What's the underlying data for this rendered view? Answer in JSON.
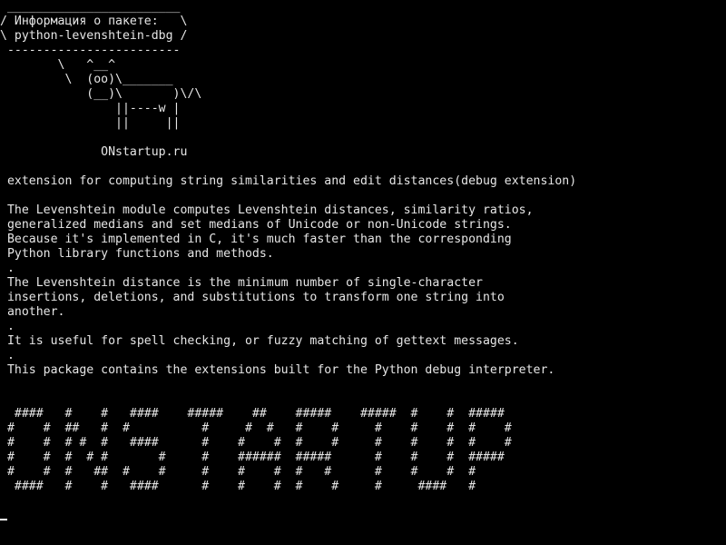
{
  "colors": {
    "background": "#000000",
    "foreground": "#e6e6e6",
    "cursor": "#ffffff"
  },
  "terminal": {
    "lines": [
      " ________________________",
      "/ Информация о пакете:   \\",
      "\\ python-levenshtein-dbg /",
      " ------------------------",
      "        \\   ^__^",
      "         \\  (oo)\\_______",
      "            (__)\\       )\\/\\",
      "                ||----w |",
      "                ||     ||",
      "",
      "              ONstartup.ru",
      "",
      " extension for computing string similarities and edit distances(debug extension)",
      "",
      " The Levenshtein module computes Levenshtein distances, similarity ratios,",
      " generalized medians and set medians of Unicode or non-Unicode strings.",
      " Because it's implemented in C, it's much faster than the corresponding",
      " Python library functions and methods.",
      " .",
      " The Levenshtein distance is the minimum number of single-character",
      " insertions, deletions, and substitutions to transform one string into",
      " another.",
      " .",
      " It is useful for spell checking, or fuzzy matching of gettext messages.",
      " .",
      " This package contains the extensions built for the Python debug interpreter.",
      "",
      "",
      "  ####   #    #   ####    #####    ##    #####    #####  #    #  #####",
      " #    #  ##   #  #          #     #  #   #    #     #    #    #  #    #",
      " #    #  # #  #   ####      #    #    #  #    #     #    #    #  #    #",
      " #    #  #  # #       #     #    ######  #####      #    #    #  #####",
      " #    #  #   ##  #    #     #    #    #  #   #      #    #    #  #",
      "  ####   #    #   ####      #    #    #  #    #     #     ####   #"
    ]
  }
}
